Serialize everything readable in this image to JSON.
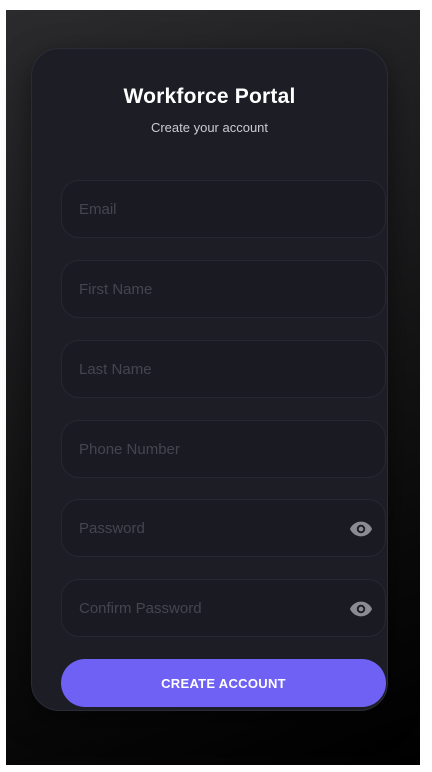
{
  "header": {
    "title": "Workforce Portal",
    "subtitle": "Create your account"
  },
  "form": {
    "fields": [
      {
        "id": "email",
        "placeholder": "Email",
        "value": ""
      },
      {
        "id": "first_name",
        "placeholder": "First Name",
        "value": ""
      },
      {
        "id": "last_name",
        "placeholder": "Last Name",
        "value": ""
      },
      {
        "id": "phone",
        "placeholder": "Phone Number",
        "value": ""
      },
      {
        "id": "password",
        "placeholder": "Password",
        "value": "",
        "icon": "eye-icon"
      },
      {
        "id": "confirm_password",
        "placeholder": "Confirm Password",
        "value": "",
        "icon": "eye-icon"
      }
    ],
    "submit_label": "CREATE ACCOUNT"
  },
  "colors": {
    "accent": "#6f61f4",
    "card_background": "#1d1e25",
    "field_background": "#1a1b22",
    "placeholder": "#44454f",
    "icon": "#8a8b93"
  }
}
